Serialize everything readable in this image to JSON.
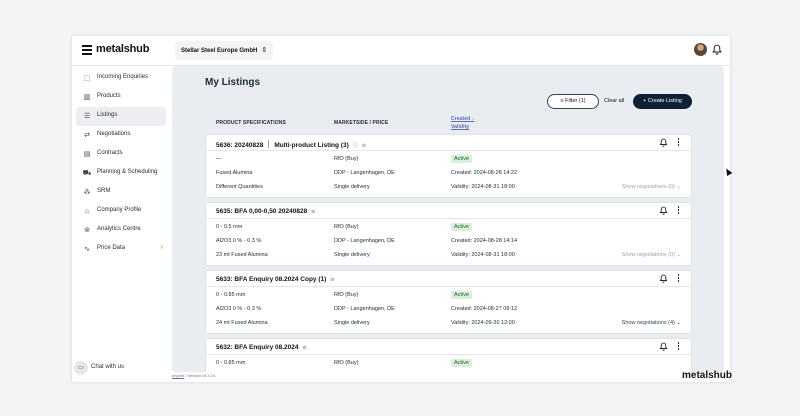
{
  "app": {
    "logo_text": "metalshub",
    "company": "Stellar Steel Europe GmbH",
    "version_link": "Imprint",
    "version_text": "/ Version v3.3.14",
    "footer_logo": "metalshub"
  },
  "sidebar": {
    "items": [
      {
        "label": "Incoming Enquiries",
        "icon": "inbox-icon"
      },
      {
        "label": "Products",
        "icon": "barcode-icon"
      },
      {
        "label": "Listings",
        "icon": "list-icon",
        "active": true
      },
      {
        "label": "Negotiations",
        "icon": "handshake-icon"
      },
      {
        "label": "Contracts",
        "icon": "document-icon"
      },
      {
        "label": "Planning & Scheduling",
        "icon": "truck-icon"
      },
      {
        "label": "SRM",
        "icon": "network-icon"
      },
      {
        "label": "Company Profile",
        "icon": "building-icon"
      },
      {
        "label": "Analytics Centre",
        "icon": "analytics-icon"
      },
      {
        "label": "Price Data",
        "icon": "chart-line-icon"
      }
    ],
    "chat_label": "Chat with us"
  },
  "main": {
    "title": "My Listings",
    "filter_label": "Filter (1)",
    "clear_label": "Clear all",
    "create_label": "Create Listing",
    "columns": {
      "spec": "PRODUCT SPECIFICATIONS",
      "market": "MARKETSIDE / PRICE",
      "created": "Created",
      "validity": "Validity"
    },
    "listings": [
      {
        "id": "5636: 20240828",
        "subtitle": "Multi-product Listing (3)",
        "rows": [
          [
            "—",
            "RfO (Buy)",
            ""
          ],
          [
            "Fused Alumina",
            "DDP - Langenhagen, DE",
            "Created: 2024-08-28 14:22"
          ],
          [
            "Different Quantities",
            "Single delivery",
            "Validity: 2024-08-31 18:00"
          ]
        ],
        "status": "Active",
        "negotiations": "Show negotiations (0)"
      },
      {
        "id": "5635: BFA 0,00-0,50 20240828",
        "subtitle": "",
        "rows": [
          [
            "0 - 0.5 mm",
            "RfO (Buy)",
            ""
          ],
          [
            "Al2O3 0 % - 0.3 %",
            "DDP - Langenhagen, DE",
            "Created: 2024-08-28 14:14"
          ],
          [
            "23 mt Fused Alumina",
            "Single delivery",
            "Validity: 2024-08-31 18:00"
          ]
        ],
        "status": "Active",
        "negotiations": "Show negotiations (0)"
      },
      {
        "id": "5633: BFA Enquiry 08.2024 Copy (1)",
        "subtitle": "",
        "rows": [
          [
            "0 - 0.85 mm",
            "RfO (Buy)",
            ""
          ],
          [
            "Al2O3 0 % - 0.3 %",
            "DDP - Langenhagen, DE",
            "Created: 2024-08-27 08:12"
          ],
          [
            "24 mt Fused Alumina",
            "Single delivery",
            "Validity: 2024-09-30 12:00"
          ]
        ],
        "status": "Active",
        "negotiations": "Show negotiations (4)"
      },
      {
        "id": "5632: BFA Enquiry 08.2024",
        "subtitle": "",
        "rows": [
          [
            "0 - 0.85 mm",
            "RfO (Buy)",
            ""
          ]
        ],
        "status": "Active",
        "negotiations": ""
      }
    ]
  }
}
